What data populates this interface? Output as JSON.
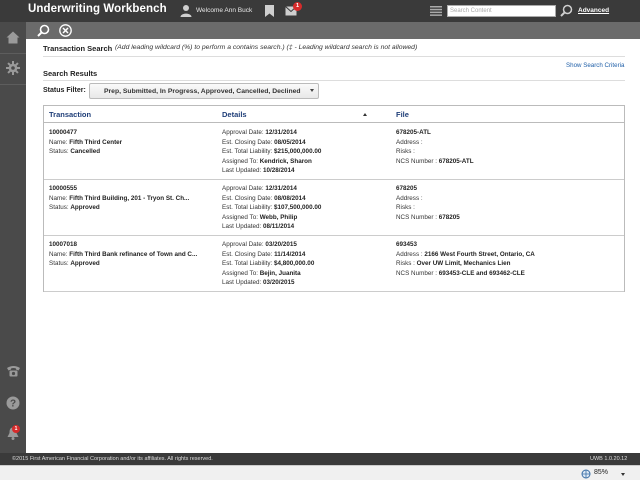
{
  "app": {
    "title": "Underwriting Workbench"
  },
  "header": {
    "welcome": "Welcome Ann Buck",
    "mail_count": "1",
    "search_placeholder": "Search Content",
    "advanced_label": "Advanced"
  },
  "left_rail": {
    "icons": [
      "home-icon",
      "gear-icon",
      "phone-icon",
      "help-icon",
      "bell-icon"
    ],
    "bell_count": "1"
  },
  "toolbar": {
    "icons": [
      "search-icon",
      "close-icon"
    ]
  },
  "search": {
    "title": "Transaction Search",
    "hint": "(Add leading wildcard (%) to perform a contains search.) (‡ - Leading wildcard search is not allowed)",
    "show_criteria": "Show Search Criteria"
  },
  "results": {
    "title": "Search Results",
    "status_label": "Status Filter:",
    "status_value": "Prep, Submitted, In Progress, Approved, Cancelled, Declined"
  },
  "table": {
    "columns": [
      "Transaction",
      "Details",
      "File"
    ],
    "rows": [
      {
        "id": "10000477",
        "name_label": "Name:",
        "name": "Fifth Third Center",
        "status_label": "Status:",
        "status": "Cancelled",
        "approval_label": "Approval Date:",
        "approval": "12/31/2014",
        "closing_label": "Est. Closing Date:",
        "closing": "08/05/2014",
        "liability_label": "Est. Total Liability:",
        "liability": "$215,000,000.00",
        "assigned_label": "Assigned To:",
        "assigned": "Kendrick, Sharon",
        "updated_label": "Last Updated:",
        "updated": "10/28/2014",
        "file": "678205-ATL",
        "address_label": "Address :",
        "address": "",
        "risks_label": "Risks :",
        "risks": "",
        "ncs_label": "NCS Number :",
        "ncs": "678205-ATL"
      },
      {
        "id": "10000555",
        "name_label": "Name:",
        "name": "Fifth Third Building, 201 - Tryon St. Ch...",
        "status_label": "Status:",
        "status": "Approved",
        "approval_label": "Approval Date:",
        "approval": "12/31/2014",
        "closing_label": "Est. Closing Date:",
        "closing": "08/08/2014",
        "liability_label": "Est. Total Liability:",
        "liability": "$107,500,000.00",
        "assigned_label": "Assigned To:",
        "assigned": "Webb, Philip",
        "updated_label": "Last Updated:",
        "updated": "08/11/2014",
        "file": "678205",
        "address_label": "Address :",
        "address": "",
        "risks_label": "Risks :",
        "risks": "",
        "ncs_label": "NCS Number :",
        "ncs": "678205"
      },
      {
        "id": "10007018",
        "name_label": "Name:",
        "name": "Fifth Third Bank refinance of Town and C...",
        "status_label": "Status:",
        "status": "Approved",
        "approval_label": "Approval Date:",
        "approval": "03/20/2015",
        "closing_label": "Est. Closing Date:",
        "closing": "11/14/2014",
        "liability_label": "Est. Total Liability:",
        "liability": "$4,800,000.00",
        "assigned_label": "Assigned To:",
        "assigned": "Bejin, Juanita",
        "updated_label": "Last Updated:",
        "updated": "03/20/2015",
        "file": "693453",
        "address_label": "Address :",
        "address": "2166 West Fourth Street, Ontario, CA",
        "risks_label": "Risks :",
        "risks": "Over UW Limit, Mechanics Lien",
        "ncs_label": "NCS Number :",
        "ncs": "693453-CLE and 693462-CLE"
      }
    ]
  },
  "footer": {
    "copyright": "©2015 First American Financial Corporation and/or its affiliates. All rights reserved.",
    "version": "UWB 1.0.20.12"
  },
  "statusbar": {
    "zoom": "85%"
  },
  "colors": {
    "topbar": "#3a3a3a",
    "rail": "#4a4a4a",
    "toolbar": "#6b6b6b",
    "header_text": "#1f3e78",
    "badge": "#d62b2b",
    "link": "#1f5fa8"
  }
}
